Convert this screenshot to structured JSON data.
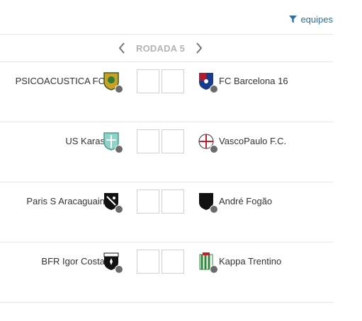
{
  "filter": {
    "label": "equipes",
    "icon": "filter-icon"
  },
  "round": {
    "label": "RODADA 5",
    "prev_icon": "chevron-left-icon",
    "next_icon": "chevron-right-icon"
  },
  "matches": [
    {
      "home": "PSICOACUSTICA FC",
      "away": "FC Barcelona 16",
      "home_score": "",
      "away_score": ""
    },
    {
      "home": "US Karas",
      "away": "VascoPaulo F.C.",
      "home_score": "",
      "away_score": ""
    },
    {
      "home": "Paris S Aracaguain",
      "away": "André Fogão",
      "home_score": "",
      "away_score": ""
    },
    {
      "home": "BFR Igor Costa",
      "away": "Kappa Trentino",
      "home_score": "",
      "away_score": ""
    }
  ],
  "colors": {
    "accent": "#2e6fa3",
    "muted": "#b3b3b3",
    "border": "#e6e6e6"
  }
}
